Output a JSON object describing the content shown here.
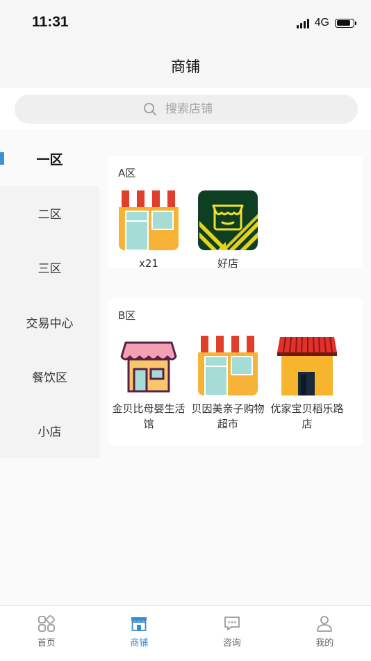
{
  "status": {
    "time": "11:31",
    "network": "4G"
  },
  "header": {
    "title": "商铺"
  },
  "search": {
    "placeholder": "搜索店铺"
  },
  "sidebar": {
    "items": [
      {
        "label": "一区",
        "active": true
      },
      {
        "label": "二区"
      },
      {
        "label": "三区"
      },
      {
        "label": "交易中心"
      },
      {
        "label": "餐饮区"
      },
      {
        "label": "小店"
      }
    ]
  },
  "zones": [
    {
      "title": "A区",
      "shops": [
        {
          "name": "x21",
          "icon": "shop-awning-icon"
        },
        {
          "name": "好店",
          "icon": "green-shop-icon"
        }
      ]
    },
    {
      "title": "B区",
      "shops": [
        {
          "name": "金贝比母婴生活馆",
          "icon": "pink-shop-icon"
        },
        {
          "name": "贝因美亲子购物超市",
          "icon": "shop-awning-icon"
        },
        {
          "name": "优家宝贝稻乐路店",
          "icon": "red-roof-shop-icon"
        }
      ]
    }
  ],
  "tabs": [
    {
      "label": "首页",
      "icon": "home-grid-icon"
    },
    {
      "label": "商铺",
      "icon": "store-icon",
      "active": true
    },
    {
      "label": "咨询",
      "icon": "chat-icon"
    },
    {
      "label": "我的",
      "icon": "user-icon"
    }
  ],
  "colors": {
    "accent": "#3b8bd1",
    "indicator": "#3b93d6"
  }
}
